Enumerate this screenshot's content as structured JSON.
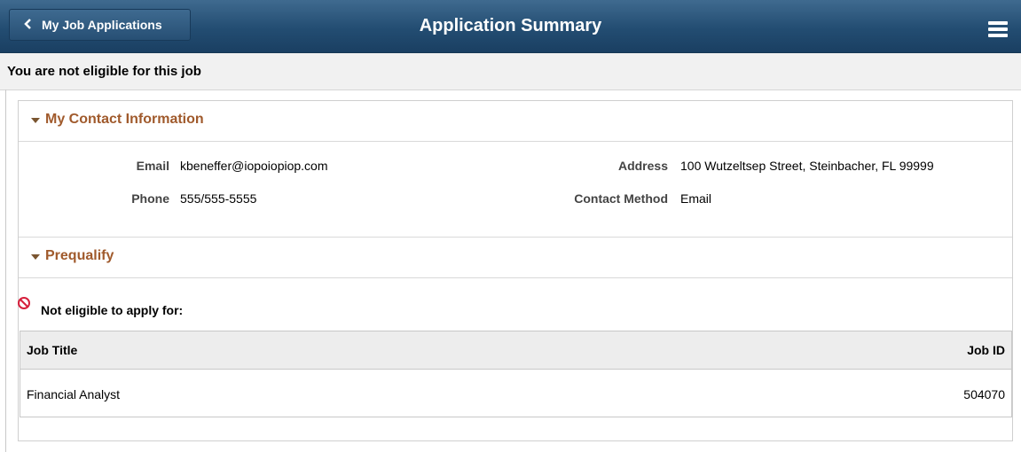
{
  "header": {
    "back_label": "My Job Applications",
    "title": "Application Summary",
    "back_icon": "chevron-left-icon",
    "menu_icon": "hamburger-menu-icon"
  },
  "banner": {
    "message": "You are not eligible for this job"
  },
  "contact": {
    "section_title": "My Contact Information",
    "email_label": "Email",
    "email_value": "kbeneffer@iopoiopiop.com",
    "phone_label": "Phone",
    "phone_value": "555/555-5555",
    "address_label": "Address",
    "address_value": "100 Wutzeltsep Street, Steinbacher, FL 99999",
    "method_label": "Contact Method",
    "method_value": "Email"
  },
  "prequalify": {
    "section_title": "Prequalify",
    "warning_text": "Not eligible to apply for:",
    "warning_icon": "prohibited-icon",
    "table": {
      "columns": [
        "Job Title",
        "Job ID"
      ],
      "rows": [
        [
          "Financial Analyst",
          "504070"
        ]
      ]
    }
  },
  "colors": {
    "header_bg": "#234d72",
    "section_title": "#a05a2c",
    "warning_icon": "#d6203c"
  }
}
